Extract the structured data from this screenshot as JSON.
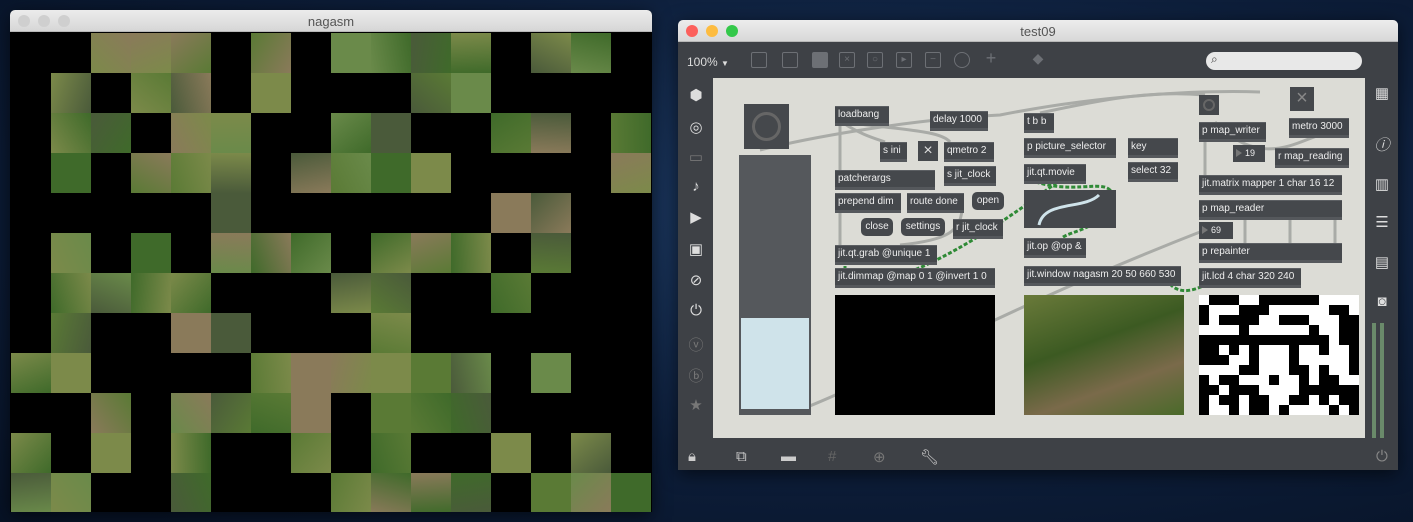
{
  "left_window": {
    "title": "nagasm"
  },
  "right_window": {
    "title": "test09",
    "toolbar": {
      "zoom": "100%",
      "zoom_arrow": "▼",
      "search_placeholder": ""
    },
    "patch": {
      "loadbang": "loadbang",
      "delay": "delay 1000",
      "s_ini": "s ini",
      "qmetro": "qmetro 2",
      "s_jit_clock": "s jit_clock",
      "patcherargs": "patcherargs",
      "prepend_dim": "prepend dim",
      "route_done": "route done",
      "open": "open",
      "close": "close",
      "settings": "settings",
      "r_jit_clock": "r jit_clock",
      "qt_grab": "jit.qt.grab @unique 1",
      "dimmap": "jit.dimmap @map 0 1 @invert 1 0",
      "tbb": "t b b",
      "picture_selector": "p picture_selector",
      "key": "key",
      "select": "select 32",
      "qt_movie": "jit.qt.movie",
      "jit_op": "jit.op @op &",
      "jit_window": "jit.window nagasm 20 50 660 530",
      "map_writer": "p map_writer",
      "metro": "metro 3000",
      "num19": "19",
      "r_map_reading": "r map_reading",
      "matrix_mapper": "jit.matrix mapper 1 char 16 12",
      "map_reader": "p map_reader",
      "num69": "69",
      "repainter": "p repainter",
      "jit_lcd": "jit.lcd 4 char 320 240"
    }
  }
}
